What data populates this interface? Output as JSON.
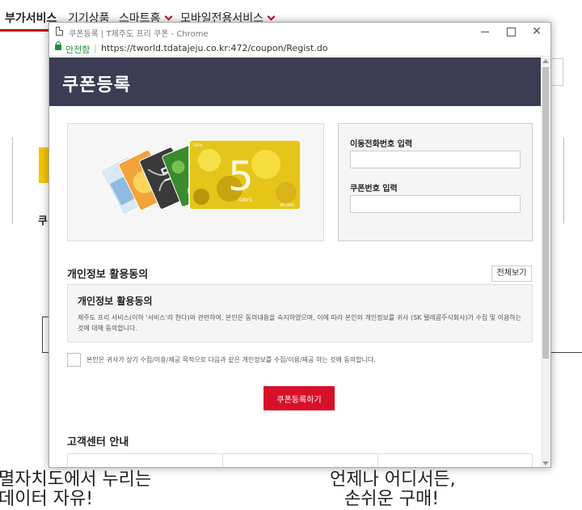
{
  "background": {
    "nav": [
      {
        "label": "부가서비스",
        "active": true
      },
      {
        "label": "기기상품",
        "active": false
      },
      {
        "label": "스마트홈",
        "active": false,
        "dropdown": true
      },
      {
        "label": "모바일전용서비스",
        "active": false,
        "dropdown": true
      }
    ],
    "left_char": "쿠",
    "bottom_left_line1": "멸자치도에서 누리는",
    "bottom_left_line2": "데이터 자유!",
    "bottom_right_line1": "언제나 어디서든,",
    "bottom_right_line2": "손쉬운 구매!"
  },
  "window": {
    "title": "쿠폰등록 | T제주도 프리 쿠폰 - Chrome",
    "secure_label": "안전함",
    "url": "https://tworld.tdatajeju.co.kr:472/coupon/Regist.do",
    "controls": {
      "minimize": "minimize",
      "maximize": "maximize",
      "close": "✕"
    }
  },
  "page": {
    "header_title": "쿠폰등록",
    "cards_image": {
      "large_card_text": "5",
      "large_card_sub": "DAYS",
      "large_card_value": "49,000",
      "large_card_top": "TDATA"
    },
    "phone_label": "이동전화번호 입력",
    "phone_value": "",
    "coupon_label": "쿠폰번호 입력",
    "coupon_value": "",
    "privacy_section_title": "개인정보 활용동의",
    "view_all_label": "전체보기",
    "terms_title": "개인정보 활용동의",
    "terms_body": "제주도 프리 서비스(이하 '서비스'라 한다)와 관련하여, 본인은 동의내용을 숙지하였으며, 이에 따라 본인의 개인정보를 귀사 (SK 텔레콤주식회사)가 수집 및 이용하는 것에 대해 동의합니다.",
    "agree_text": "본인은 귀사가 상기 수집/이용/제공 목적으로 다음과 같은 개인정보를 수집/이용/제공 하는 것에 동의합니다.",
    "agree_checked": false,
    "submit_label": "쿠폰등록하기",
    "customer_center_title": "고객센터 안내"
  }
}
